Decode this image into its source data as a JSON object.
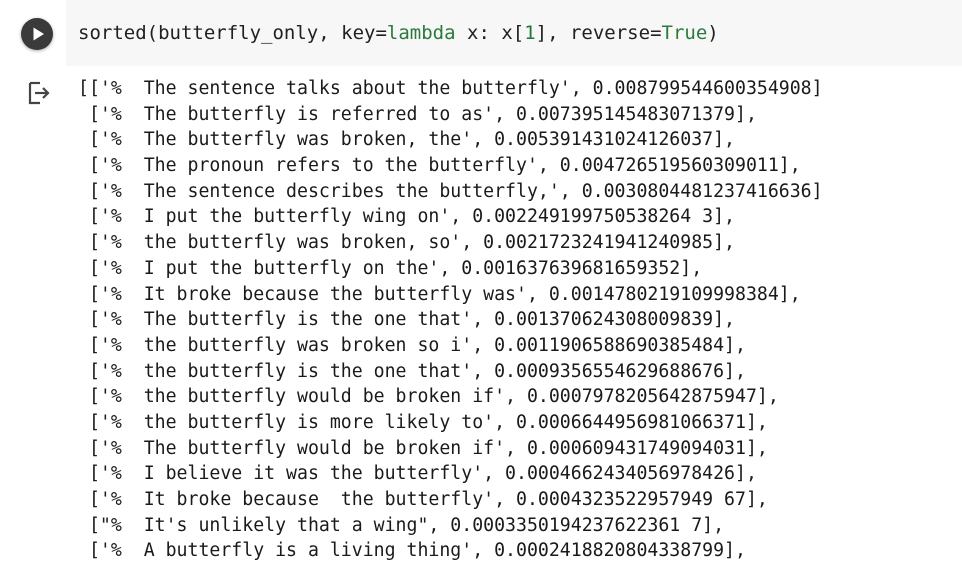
{
  "code_cell": {
    "run_icon": "play-icon",
    "code": {
      "func": "sorted",
      "open": "(",
      "arg1": "butterfly_only",
      "sep1": ", ",
      "kwarg": "key",
      "eq1": "=",
      "lambda_kw": "lambda",
      "lambda_body": " x: x[",
      "index": "1",
      "close_idx": "], ",
      "kwarg2": "reverse",
      "eq2": "=",
      "bool": "True",
      "close": ")"
    }
  },
  "output": {
    "icon": "output-arrow-icon",
    "lines": [
      "[['%  The sentence talks about the butterfly', 0.008799544600354908]",
      " ['%  The butterfly is referred to as', 0.007395145483071379],",
      " ['%  The butterfly was broken, the', 0.005391431024126037],",
      " ['%  The pronoun refers to the butterfly', 0.004726519560309011],",
      " ['%  The sentence describes the butterfly,', 0.0030804481237416636]",
      " ['%  I put the butterfly wing on', 0.002249199750538264 3],",
      " ['%  the butterfly was broken, so', 0.0021723241941240985],",
      " ['%  I put the butterfly on the', 0.001637639681659352],",
      " ['%  It broke because the butterfly was', 0.0014780219109998384],",
      " ['%  The butterfly is the one that', 0.001370624308009839],",
      " ['%  the butterfly was broken so i', 0.0011906588690385484],",
      " ['%  the butterfly is the one that', 0.0009356554629688676],",
      " ['%  the butterfly would be broken if', 0.0007978205642875947],",
      " ['%  the butterfly is more likely to', 0.0006644956981066371],",
      " ['%  The butterfly would be broken if', 0.000609431749094031],",
      " ['%  I believe it was the butterfly', 0.0004662434056978426],",
      " ['%  It broke because  the butterfly', 0.0004323522957949 67],",
      " [\"%  It's unlikely that a wing\", 0.0003350194237622361 7],",
      " ['%  A butterfly is a living thing', 0.0002418820804338799],"
    ]
  }
}
